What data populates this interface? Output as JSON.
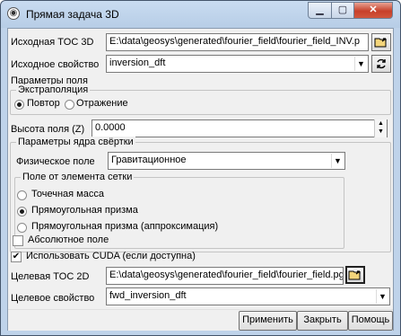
{
  "window": {
    "title": "Прямая задача 3D",
    "app_icon": "globe-icon",
    "controls": {
      "minimize": "▁",
      "maximize": "▢",
      "close": "✕"
    }
  },
  "source_toc": {
    "label": "Исходная TOC 3D",
    "value": "E:\\data\\geosys\\generated\\fourier_field\\fourier_field_INV.p",
    "button_icon": "open-folder-icon"
  },
  "source_prop": {
    "label": "Исходное свойство",
    "value": "inversion_dft",
    "arrow": "▼",
    "button_icon": "refresh-icon"
  },
  "field_params": {
    "title": "Параметры поля",
    "extrapolation": {
      "title": "Экстраполяция",
      "options": [
        "Повтор",
        "Отражение"
      ],
      "selected": "Повтор"
    },
    "height": {
      "label": "Высота поля (Z)",
      "value": "0.0000"
    }
  },
  "kernel_params": {
    "title": "Параметры ядра свёртки",
    "physical_field": {
      "label": "Физическое поле",
      "value": "Гравитационное",
      "arrow": "▼"
    },
    "element_field": {
      "title": "Поле от элемента сетки",
      "options": [
        "Точечная масса",
        "Прямоугольная призма",
        "Прямоугольная призма (аппроксимация)"
      ],
      "selected": "Прямоугольная призма"
    }
  },
  "absolute_field": {
    "label": "Абсолютное поле",
    "checked": false
  },
  "use_cuda": {
    "label": "Использовать CUDA (если доступна)",
    "checked": true,
    "mark": "✔"
  },
  "target_toc": {
    "label": "Целевая TOC 2D",
    "value": "E:\\data\\geosys\\generated\\fourier_field\\fourier_field.pgrid",
    "button_icon": "open-folder-icon"
  },
  "target_prop": {
    "label": "Целевое свойство",
    "value": "fwd_inversion_dft",
    "arrow": "▼"
  },
  "buttons": {
    "apply": "Применить",
    "close": "Закрыть",
    "help": "Помощь"
  }
}
